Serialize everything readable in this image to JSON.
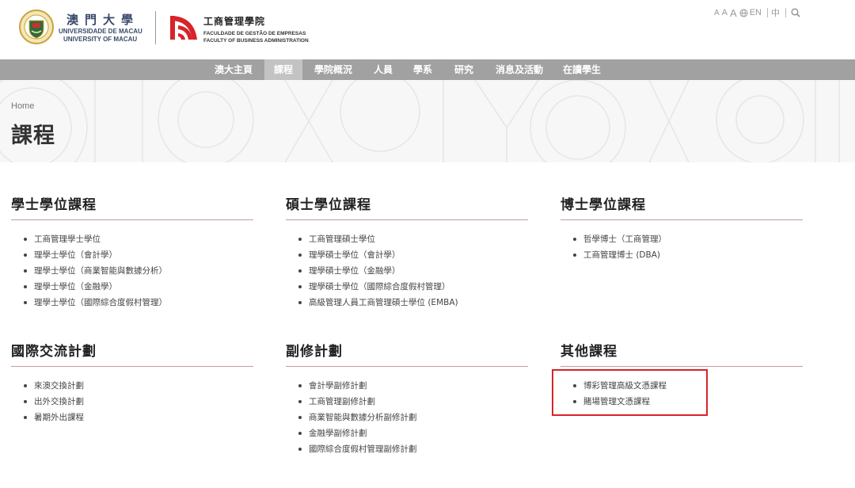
{
  "header": {
    "um_chinese": "澳門大學",
    "um_en_1": "UNIVERSIDADE DE MACAU",
    "um_en_2": "UNIVERSITY OF MACAU",
    "fba_cn": "工商管理學院",
    "fba_pt": "FACULDADE DE GESTÃO DE EMPRESAS",
    "fba_en": "FACULTY OF BUSINESS ADMINISTRATION",
    "tools": {
      "a_small": "A",
      "a_medium": "A",
      "a_large": "A",
      "en": "EN",
      "zh": "中"
    }
  },
  "nav": {
    "items": [
      "澳大主頁",
      "課程",
      "學院概況",
      "人員",
      "學系",
      "研究",
      "消息及活動",
      "在讀學生"
    ],
    "active": "課程"
  },
  "hero": {
    "breadcrumb": "Home",
    "title": "課程"
  },
  "sections": [
    {
      "title": "學士學位課程",
      "items": [
        "工商管理學士學位",
        "理學士學位（會計學）",
        "理學士學位（商業智能與數據分析）",
        "理學士學位（金融學）",
        "理學士學位（國際綜合度假村管理）"
      ]
    },
    {
      "title": "碩士學位課程",
      "items": [
        "工商管理碩士學位",
        "理學碩士學位（會計學）",
        "理學碩士學位（金融學）",
        "理學碩士學位（國際綜合度假村管理）",
        "高級管理人員工商管理碩士學位 (EMBA)"
      ]
    },
    {
      "title": "博士學位課程",
      "items": [
        "哲學博士（工商管理）",
        "工商管理博士 (DBA)"
      ]
    },
    {
      "title": "國際交流計劃",
      "items": [
        "來澳交換計劃",
        "出外交換計劃",
        "暑期外出課程"
      ]
    },
    {
      "title": "副修計劃",
      "items": [
        "會計學副修計劃",
        "工商管理副修計劃",
        "商業智能與數據分析副修計劃",
        "金融學副修計劃",
        "國際綜合度假村管理副修計劃"
      ]
    },
    {
      "title": "其他課程",
      "items": [
        "博彩管理高級文憑課程",
        "賭場管理文憑課程"
      ]
    }
  ],
  "colors": {
    "nav_bg": "#a1a1a1",
    "nav_active": "#c3c3c3",
    "accent_red": "#d8232a",
    "underline": "#c99a9a"
  }
}
